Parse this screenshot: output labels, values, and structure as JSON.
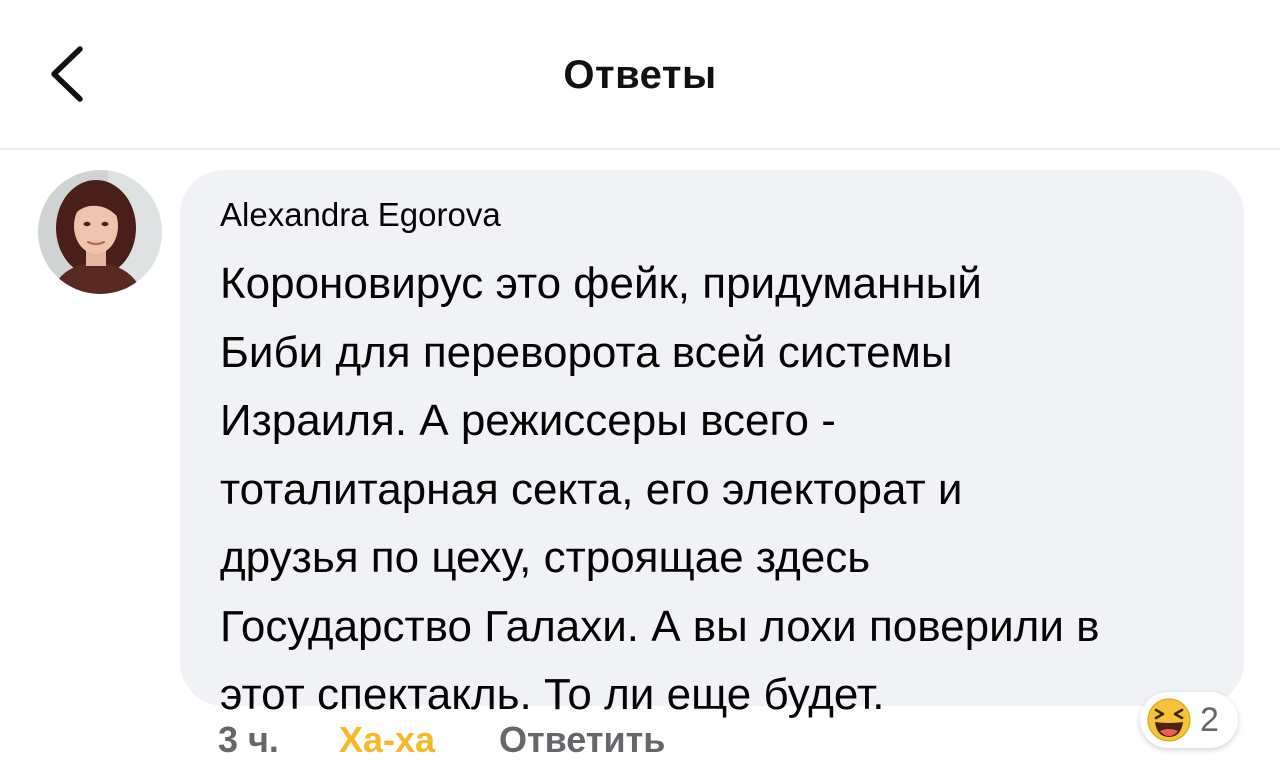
{
  "header": {
    "title": "Ответы",
    "back_icon": "chevron-left-icon"
  },
  "comment": {
    "author": "Alexandra Egorova",
    "text": "Короновирус это фейк, придуманный\nБиби для переворота всей системы\nИзраиля. А режиссеры всего -\nтоталитарная секта, его электорат и\nдрузья по цеху, строящае здесь\nГосударство Галахи. А вы лохи поверили в\nэтот спектакль. То ли еще будет.",
    "time": "3 ч.",
    "reaction_label": "Ха-ха",
    "reply_label": "Ответить",
    "reaction_icon": "laughing-emoji-icon",
    "reaction_count": "2"
  },
  "colors": {
    "bubble_bg": "#f0f2f5",
    "haha_accent": "#f7b928",
    "meta_gray": "#65676b"
  }
}
